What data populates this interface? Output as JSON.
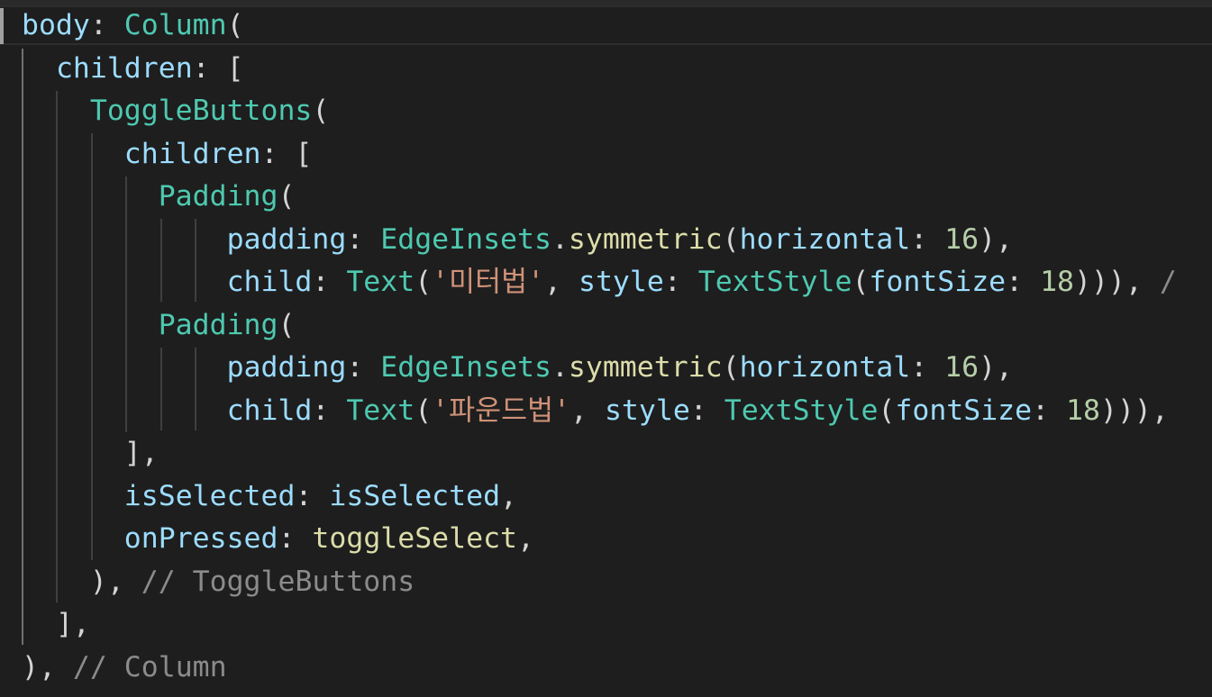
{
  "editor": {
    "lines": [
      [
        {
          "t": "body",
          "c": "prop"
        },
        {
          "t": ": ",
          "c": "punc"
        },
        {
          "t": "Column",
          "c": "type"
        },
        {
          "t": "(",
          "c": "punc"
        }
      ],
      [
        {
          "t": "  ",
          "c": "punc"
        },
        {
          "t": "children",
          "c": "prop"
        },
        {
          "t": ": [",
          "c": "punc"
        }
      ],
      [
        {
          "t": "    ",
          "c": "punc"
        },
        {
          "t": "ToggleButtons",
          "c": "type"
        },
        {
          "t": "(",
          "c": "punc"
        }
      ],
      [
        {
          "t": "      ",
          "c": "punc"
        },
        {
          "t": "children",
          "c": "prop"
        },
        {
          "t": ": [",
          "c": "punc"
        }
      ],
      [
        {
          "t": "        ",
          "c": "punc"
        },
        {
          "t": "Padding",
          "c": "type"
        },
        {
          "t": "(",
          "c": "punc"
        }
      ],
      [
        {
          "t": "            ",
          "c": "punc"
        },
        {
          "t": "padding",
          "c": "prop"
        },
        {
          "t": ": ",
          "c": "punc"
        },
        {
          "t": "EdgeInsets",
          "c": "type"
        },
        {
          "t": ".",
          "c": "punc"
        },
        {
          "t": "symmetric",
          "c": "fn"
        },
        {
          "t": "(",
          "c": "punc"
        },
        {
          "t": "horizontal",
          "c": "prop"
        },
        {
          "t": ": ",
          "c": "punc"
        },
        {
          "t": "16",
          "c": "num"
        },
        {
          "t": "),",
          "c": "punc"
        }
      ],
      [
        {
          "t": "            ",
          "c": "punc"
        },
        {
          "t": "child",
          "c": "prop"
        },
        {
          "t": ": ",
          "c": "punc"
        },
        {
          "t": "Text",
          "c": "type"
        },
        {
          "t": "(",
          "c": "punc"
        },
        {
          "t": "'미터법'",
          "c": "str"
        },
        {
          "t": ", ",
          "c": "punc"
        },
        {
          "t": "style",
          "c": "prop"
        },
        {
          "t": ": ",
          "c": "punc"
        },
        {
          "t": "TextStyle",
          "c": "type"
        },
        {
          "t": "(",
          "c": "punc"
        },
        {
          "t": "fontSize",
          "c": "prop"
        },
        {
          "t": ": ",
          "c": "punc"
        },
        {
          "t": "18",
          "c": "num"
        },
        {
          "t": "))), ",
          "c": "punc"
        },
        {
          "t": "/",
          "c": "hint"
        }
      ],
      [
        {
          "t": "        ",
          "c": "punc"
        },
        {
          "t": "Padding",
          "c": "type"
        },
        {
          "t": "(",
          "c": "punc"
        }
      ],
      [
        {
          "t": "            ",
          "c": "punc"
        },
        {
          "t": "padding",
          "c": "prop"
        },
        {
          "t": ": ",
          "c": "punc"
        },
        {
          "t": "EdgeInsets",
          "c": "type"
        },
        {
          "t": ".",
          "c": "punc"
        },
        {
          "t": "symmetric",
          "c": "fn"
        },
        {
          "t": "(",
          "c": "punc"
        },
        {
          "t": "horizontal",
          "c": "prop"
        },
        {
          "t": ": ",
          "c": "punc"
        },
        {
          "t": "16",
          "c": "num"
        },
        {
          "t": "),",
          "c": "punc"
        }
      ],
      [
        {
          "t": "            ",
          "c": "punc"
        },
        {
          "t": "child",
          "c": "prop"
        },
        {
          "t": ": ",
          "c": "punc"
        },
        {
          "t": "Text",
          "c": "type"
        },
        {
          "t": "(",
          "c": "punc"
        },
        {
          "t": "'파운드법'",
          "c": "str"
        },
        {
          "t": ", ",
          "c": "punc"
        },
        {
          "t": "style",
          "c": "prop"
        },
        {
          "t": ": ",
          "c": "punc"
        },
        {
          "t": "TextStyle",
          "c": "type"
        },
        {
          "t": "(",
          "c": "punc"
        },
        {
          "t": "fontSize",
          "c": "prop"
        },
        {
          "t": ": ",
          "c": "punc"
        },
        {
          "t": "18",
          "c": "num"
        },
        {
          "t": "))),",
          "c": "punc"
        }
      ],
      [
        {
          "t": "      ",
          "c": "punc"
        },
        {
          "t": "],",
          "c": "punc"
        }
      ],
      [
        {
          "t": "      ",
          "c": "punc"
        },
        {
          "t": "isSelected",
          "c": "prop"
        },
        {
          "t": ": ",
          "c": "punc"
        },
        {
          "t": "isSelected",
          "c": "prop"
        },
        {
          "t": ",",
          "c": "punc"
        }
      ],
      [
        {
          "t": "      ",
          "c": "punc"
        },
        {
          "t": "onPressed",
          "c": "prop"
        },
        {
          "t": ": ",
          "c": "punc"
        },
        {
          "t": "toggleSelect",
          "c": "fn"
        },
        {
          "t": ",",
          "c": "punc"
        }
      ],
      [
        {
          "t": "    ",
          "c": "punc"
        },
        {
          "t": "), ",
          "c": "punc"
        },
        {
          "t": "// ToggleButtons",
          "c": "hint"
        }
      ],
      [
        {
          "t": "  ",
          "c": "punc"
        },
        {
          "t": "],",
          "c": "punc"
        }
      ],
      [
        {
          "t": "), ",
          "c": "punc"
        },
        {
          "t": "// Column",
          "c": "hint"
        }
      ]
    ]
  }
}
